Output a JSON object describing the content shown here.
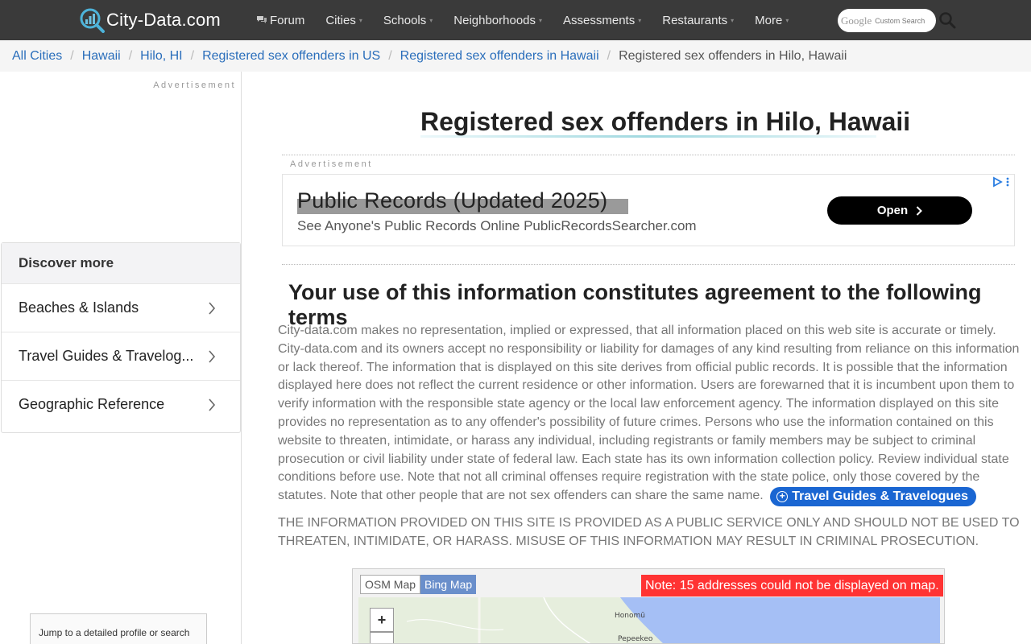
{
  "header": {
    "logo_text": "City-Data.com",
    "nav": [
      {
        "label": "Forum",
        "has_caret": false,
        "icon": "forum-icon"
      },
      {
        "label": "Cities",
        "has_caret": true
      },
      {
        "label": "Schools",
        "has_caret": true
      },
      {
        "label": "Neighborhoods",
        "has_caret": true
      },
      {
        "label": "Assessments",
        "has_caret": true
      },
      {
        "label": "Restaurants",
        "has_caret": true
      },
      {
        "label": "More",
        "has_caret": true
      }
    ],
    "search": {
      "brand": "Google",
      "label": "Custom Search",
      "icon": "search-icon"
    },
    "colors": {
      "bar": "#3a3a3a"
    }
  },
  "breadcrumb": {
    "items": [
      "All Cities",
      "Hawaii",
      "Hilo, HI",
      "Registered sex offenders in US",
      "Registered sex offenders in Hawaii"
    ],
    "current": "Registered sex offenders in Hilo, Hawaii",
    "separator": "/"
  },
  "sidebar": {
    "ad_label": "Advertisement",
    "discover_title": "Discover more",
    "items": [
      "Beaches & Islands",
      "Travel Guides & Travelog...",
      "Geographic Reference"
    ],
    "jump_text": "Jump to a detailed profile or search"
  },
  "main": {
    "title": "Registered sex offenders in Hilo, Hawaii",
    "ad_label": "Advertisement",
    "ad": {
      "headline": "Public Records (Updated 2025)",
      "subline": "See Anyone's Public Records Online PublicRecordsSearcher.com",
      "button": "Open"
    },
    "terms_title": "Your use of this information constitutes agreement to the following terms",
    "terms_body": "City-data.com makes no representation, implied or expressed, that all information placed on this web site is accurate or timely. City-data.com and its owners accept no responsibility or liability for damages of any kind resulting from reliance on this information or lack thereof. The information that is displayed on this site derives from official public records. It is possible that the information displayed here does not reflect the current residence or other information. Users are forewarned that it is incumbent upon them to verify information with the responsible state agency or the local law enforcement agency. The information displayed on this site provides no representation as to any offender's possibility of future crimes. Persons who use the information contained on this website to threaten, intimidate, or harass any individual, including registrants or family members may be subject to criminal prosecution or civil liability under state of federal law. Each state has its own information collection policy. Review individual state conditions before use. Note that not all criminal offenses require registration with the state police, only those covered by the statutes. Note that other people that are not sex offenders can share the same name.",
    "travel_pill": "Travel Guides & Travelogues",
    "caps_notice": "THE INFORMATION PROVIDED ON THIS SITE IS PROVIDED AS A PUBLIC SERVICE ONLY AND SHOULD NOT BE USED TO THREATEN, INTIMIDATE, OR HARASS. MISUSE OF THIS INFORMATION MAY RESULT IN CRIMINAL PROSECUTION.",
    "map": {
      "tab_osm": "OSM Map",
      "tab_bing": "Bing Map",
      "note": "Note: 15 addresses could not be displayed on map.",
      "zoom_in": "+",
      "places": [
        "Honomū",
        "Pepeekeo"
      ]
    }
  },
  "colors": {
    "link": "#2a6ebb",
    "pill": "#1a66d2",
    "map_note": "#ff3333",
    "bing_tab": "#6a8fcb",
    "ocean": "#a5bff5"
  }
}
